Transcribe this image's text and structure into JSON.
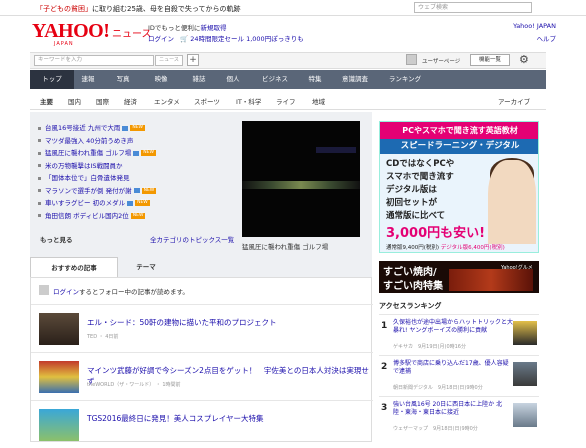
{
  "topbar": {
    "promo_part1": "「子どもの貧困」",
    "promo_part2": "に取り組む25歳、母を自殺で失ってからの軌跡",
    "search_placeholder": "ウェブ検索"
  },
  "header": {
    "logo": "YAHOO!",
    "logo_sub": "JAPAN",
    "logo_news": "ニュース",
    "id_text": "IDでもっと便利に",
    "id_link": "新規取得",
    "login": "ログイン",
    "cart_text": "24時間限定セール 1,000円ぽっきりも",
    "yahoo_japan": "Yahoo! JAPAN",
    "help": "ヘルプ"
  },
  "toolbar": {
    "keyword_placeholder": "キーワードを入力",
    "news_button": "ニュース",
    "plus": "+",
    "user_page": "ユーザーページ",
    "services": "機能一覧"
  },
  "nav": {
    "items": [
      "トップ",
      "速報",
      "写真",
      "映像",
      "雑誌",
      "個人",
      "ビジネス",
      "特集",
      "意識調査",
      "ランキング"
    ]
  },
  "subnav": {
    "items": [
      "主要",
      "国内",
      "国際",
      "経済",
      "エンタメ",
      "スポーツ",
      "IT・科学",
      "ライフ",
      "地域"
    ],
    "archive": "アーカイブ"
  },
  "topics": {
    "items": [
      {
        "text": "台風16号接近 九州で大雨",
        "badge": "NEW",
        "cam": true
      },
      {
        "text": "マツダ最強入 40分前うめき声",
        "badge": "",
        "cam": false
      },
      {
        "text": "猛風圧に襲われ重傷 ゴルフ場",
        "badge": "NEW",
        "cam": true
      },
      {
        "text": "米の万物襲撃はIS戦闘員か",
        "badge": "",
        "cam": false
      },
      {
        "text": "「国体本位で」白骨遺体発見",
        "badge": "",
        "cam": false
      },
      {
        "text": "マラソンで選手が倒 発付が謝",
        "badge": "NEW",
        "cam": true
      },
      {
        "text": "車いすラグビー 初のメダル",
        "badge": "NEW",
        "cam": true
      },
      {
        "text": "角田信朗 ボディビル国内2位",
        "badge": "NEW",
        "cam": false
      }
    ],
    "more": "もっと見る",
    "all_topics": "全カテゴリのトピックス一覧"
  },
  "video": {
    "caption": "猛風圧に襲われ重傷 ゴルフ場"
  },
  "tabs": {
    "recommended": "おすすめの記事",
    "theme": "テーマ"
  },
  "feed": {
    "login_link": "ログイン",
    "login_text": "するとフォロー中の記事が読めます。",
    "articles": [
      {
        "title": "エル・シード：50軒の建物に描いた平和のプロジェクト",
        "meta": "TED ・ 4日前"
      },
      {
        "title": "マインツ武藤が好調で今シーズン2点目をゲット！　宇佐美との日本人対決は実現せず",
        "meta": "theWORLD（ザ・ワールド） ・ 1時間前"
      },
      {
        "title": "TGS2016最終日に発見！美人コスプレイヤー大特集",
        "meta": ""
      }
    ]
  },
  "right_banner": {
    "head": "PCやスマホで聞き流す英語教材",
    "sub": "スピードラーニング・デジタル",
    "body1": "CDではなくPCや",
    "body2": "スマホで聞き流す",
    "body3": "デジタル版は",
    "body4": "初回セットが",
    "body5": "通常版に比べて",
    "price": "3,000円も安い!",
    "small1": "通常版9,400円(税別)",
    "small2": "デジタル版6,400円(税別)"
  },
  "yakiniku_banner": {
    "line1": "すごい焼肉/",
    "line2": "すごい肉特集",
    "label": "Yahoo!グルメ"
  },
  "ranking": {
    "title": "アクセスランキング",
    "items": [
      {
        "rank": "1",
        "text": "久保裕也が途中出場からハットトリックと大暴れ! ヤングボーイズの勝利に貢献",
        "meta": "ゲキサカ　9月19日(月)0時16分"
      },
      {
        "rank": "2",
        "text": "博多駅で商店に乗り込んだ17歳、優人容疑で逮捕",
        "meta": "朝日新聞デジタル　9月18日(日)9時0分"
      },
      {
        "rank": "3",
        "text": "強い台風16号 20日に西日本に上陸か 北陸・東海・東日本に接近",
        "meta": "ウェザーマップ　9月18日(日)9時0分"
      }
    ]
  },
  "colors": {
    "brand": "#e60012",
    "nav_bg": "#5a6678",
    "nav_active": "#2c3340",
    "banner_pink": "#e40074",
    "banner_blue": "#1d6ab2"
  }
}
